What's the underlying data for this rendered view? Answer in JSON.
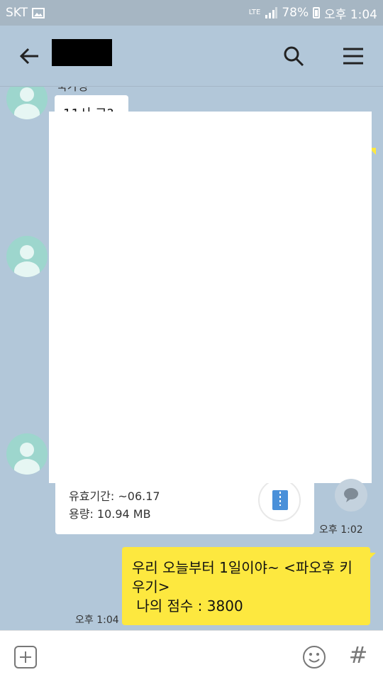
{
  "status_bar": {
    "carrier": "SKT",
    "network": "LTE",
    "battery": "78%",
    "time": "오후 1:04"
  },
  "header": {
    "title": ""
  },
  "chat": {
    "partial_sender": "국가영",
    "partial_bubble": "11시 그?",
    "file_card": {
      "validity": "유효기간: ~06.17",
      "size": "용량: 10.94 MB"
    },
    "time_received": "오후 1:02",
    "my_message": "우리 오늘부터 1일이야~ <파오후 키우기>\n 나의 점수 : 3800",
    "time_sent": "오후 1:04"
  },
  "input_bar": {
    "hash_label": "#"
  },
  "colors": {
    "background": "#b2c7d9",
    "my_bubble": "#fde83f",
    "avatar": "#9dd6cd"
  },
  "icons": {
    "back": "arrow-left-icon",
    "search": "search-icon",
    "menu": "hamburger-menu-icon",
    "share": "speech-bubble-icon",
    "attach": "plus-square-icon",
    "emoji": "smiley-icon"
  }
}
